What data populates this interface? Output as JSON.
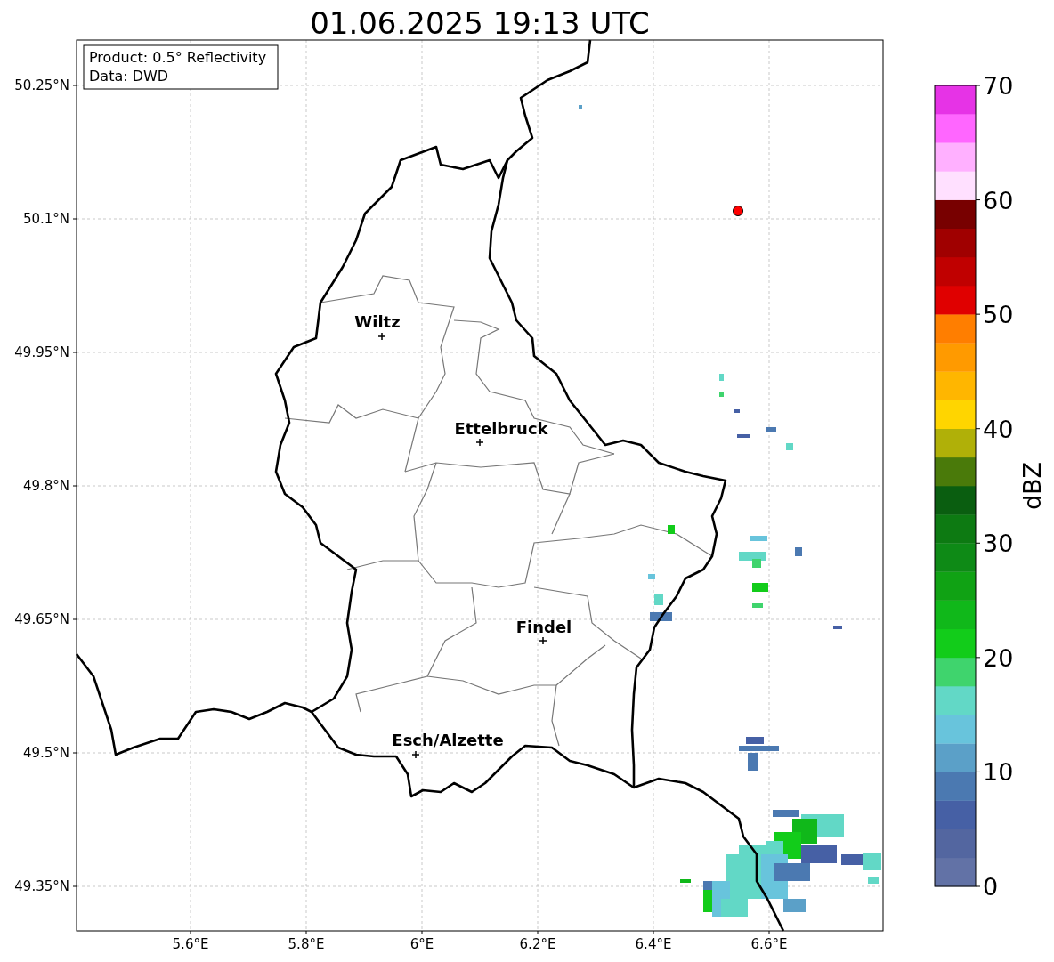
{
  "title": "01.06.2025 19:13 UTC",
  "info_box": {
    "lines": [
      "Product: 0.5° Reflectivity",
      "Data: DWD"
    ]
  },
  "map": {
    "x_ticks": [
      "5.6°E",
      "5.8°E",
      "6°E",
      "6.2°E",
      "6.4°E",
      "6.6°E"
    ],
    "y_ticks": [
      "50.25°N",
      "50.1°N",
      "49.95°N",
      "49.8°N",
      "49.65°N",
      "49.5°N",
      "49.35°N"
    ],
    "cities": [
      {
        "name": "Wiltz"
      },
      {
        "name": "Ettelbruck"
      },
      {
        "name": "Findel"
      },
      {
        "name": "Esch/Alzette"
      }
    ],
    "radar_site": {
      "color": "#ff0000"
    }
  },
  "colorbar": {
    "label": "dBZ",
    "ticks": [
      "70",
      "60",
      "50",
      "40",
      "30",
      "20",
      "10",
      "0"
    ],
    "colors": [
      {
        "color": "#6272a6"
      },
      {
        "color": "#5366a0"
      },
      {
        "color": "#4660a5"
      },
      {
        "color": "#4b79b1"
      },
      {
        "color": "#5ba0c8"
      },
      {
        "color": "#68c4dc"
      },
      {
        "color": "#62d8c6"
      },
      {
        "color": "#3fd46d"
      },
      {
        "color": "#12cc1a"
      },
      {
        "color": "#10b81a"
      },
      {
        "color": "#10a214"
      },
      {
        "color": "#0e8a16"
      },
      {
        "color": "#0d7a12"
      },
      {
        "color": "#0a5e10"
      },
      {
        "color": "#4a7a0a"
      },
      {
        "color": "#b0b008"
      },
      {
        "color": "#ffd500"
      },
      {
        "color": "#ffb600"
      },
      {
        "color": "#ff9a00"
      },
      {
        "color": "#ff7e00"
      },
      {
        "color": "#e00000"
      },
      {
        "color": "#c00000"
      },
      {
        "color": "#a00000"
      },
      {
        "color": "#780000"
      },
      {
        "color": "#ffe0ff"
      },
      {
        "color": "#ffb0ff"
      },
      {
        "color": "#ff66ff"
      },
      {
        "color": "#e633e6"
      }
    ]
  }
}
